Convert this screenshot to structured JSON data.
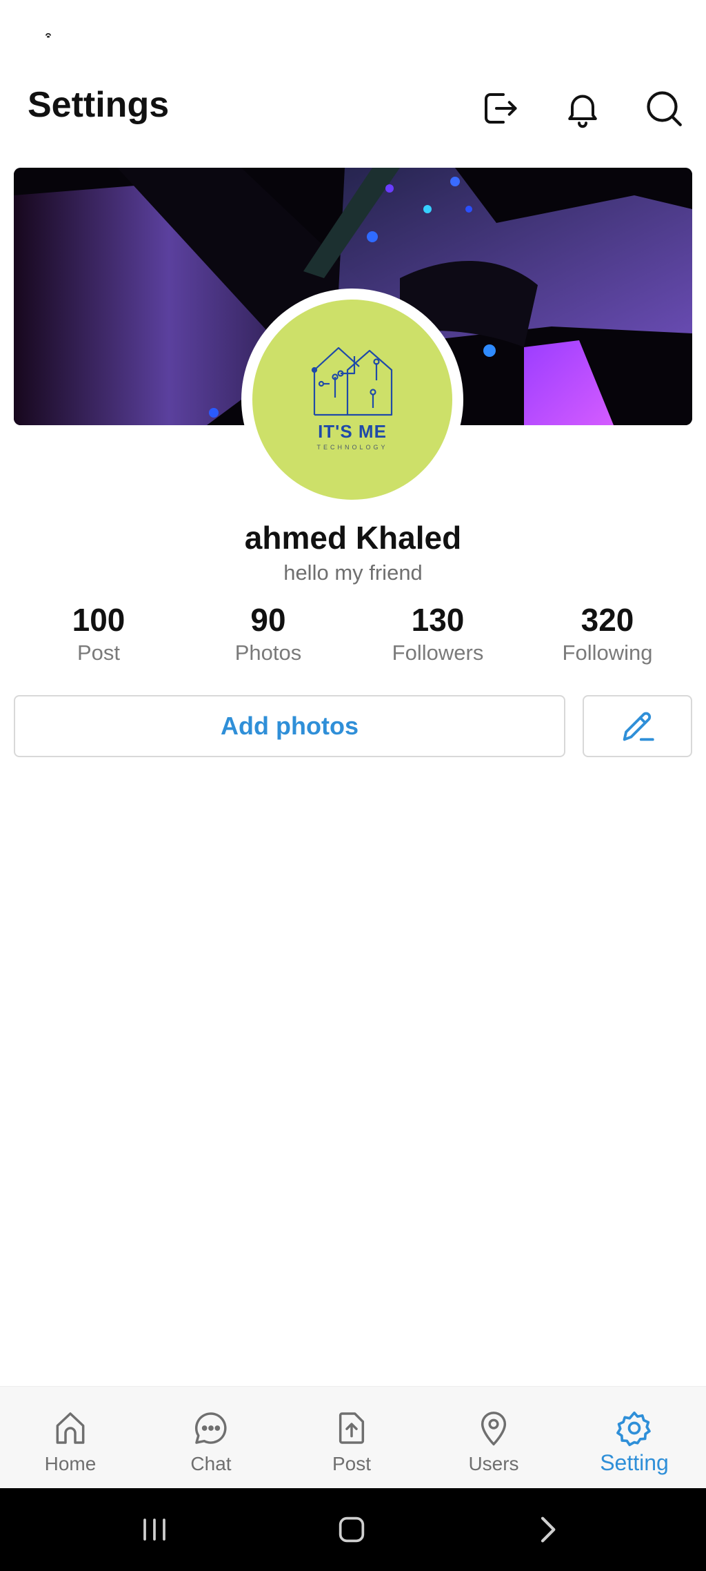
{
  "status_bar": {
    "glyph": "͒"
  },
  "header": {
    "title": "Settings",
    "icons": [
      "logout-icon",
      "bell-icon",
      "search-icon"
    ]
  },
  "profile": {
    "logo_name": "IT'S ME",
    "logo_tagline": "TECHNOLOGY",
    "name": "ahmed Khaled",
    "bio": "hello my friend"
  },
  "stats": [
    {
      "value": "100",
      "label": "Post"
    },
    {
      "value": "90",
      "label": "Photos"
    },
    {
      "value": "130",
      "label": "Followers"
    },
    {
      "value": "320",
      "label": "Following"
    }
  ],
  "actions": {
    "add_photos_label": "Add photos",
    "edit_icon": "pencil-icon"
  },
  "bottom_nav": {
    "items": [
      {
        "label": "Home",
        "icon": "home-icon",
        "active": false
      },
      {
        "label": "Chat",
        "icon": "chat-icon",
        "active": false
      },
      {
        "label": "Post",
        "icon": "upload-icon",
        "active": false
      },
      {
        "label": "Users",
        "icon": "location-pin-icon",
        "active": false
      },
      {
        "label": "Setting",
        "icon": "gear-icon",
        "active": true
      }
    ]
  },
  "colors": {
    "accent": "#2f8fd8",
    "avatar_bg": "#cde069",
    "text_primary": "#111111",
    "text_secondary": "#6f6f6f"
  }
}
